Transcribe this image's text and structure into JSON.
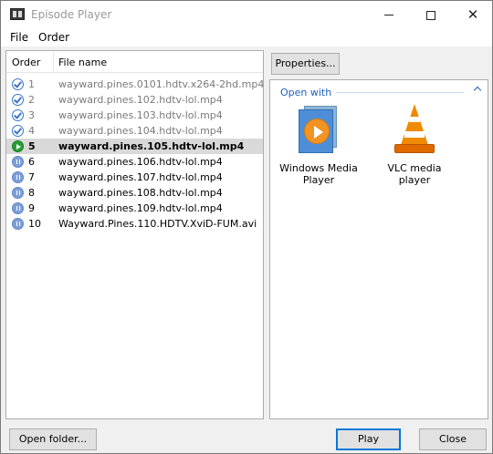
{
  "window": {
    "title": "Episode Player",
    "minimize_glyph": "",
    "maximize_glyph": "",
    "close_glyph": "✕"
  },
  "menu": {
    "file": "File",
    "order": "Order"
  },
  "list": {
    "headers": {
      "order": "Order",
      "file_name": "File name"
    },
    "rows": [
      {
        "order": "1",
        "file": "wayward.pines.0101.hdtv.x264-2hd.mp4",
        "status": "watched"
      },
      {
        "order": "2",
        "file": "wayward.pines.102.hdtv-lol.mp4",
        "status": "watched"
      },
      {
        "order": "3",
        "file": "wayward.pines.103.hdtv-lol.mp4",
        "status": "watched"
      },
      {
        "order": "4",
        "file": "wayward.pines.104.hdtv-lol.mp4",
        "status": "watched"
      },
      {
        "order": "5",
        "file": "wayward.pines.105.hdtv-lol.mp4",
        "status": "selected"
      },
      {
        "order": "6",
        "file": "wayward.pines.106.hdtv-lol.mp4",
        "status": "queued"
      },
      {
        "order": "7",
        "file": "wayward.pines.107.hdtv-lol.mp4",
        "status": "queued"
      },
      {
        "order": "8",
        "file": "wayward.pines.108.hdtv-lol.mp4",
        "status": "queued"
      },
      {
        "order": "9",
        "file": "wayward.pines.109.hdtv-lol.mp4",
        "status": "queued"
      },
      {
        "order": "10",
        "file": "Wayward.Pines.110.HDTV.XviD-FUM.avi",
        "status": "queued"
      }
    ]
  },
  "properties_button": "Properties...",
  "open_with": {
    "header": "Open with",
    "apps": [
      {
        "name": "Windows Media Player",
        "icon": "windows-media-player-icon"
      },
      {
        "name": "VLC media player",
        "icon": "vlc-icon"
      }
    ]
  },
  "buttons": {
    "open_folder": "Open folder...",
    "play": "Play",
    "close": "Close"
  },
  "colors": {
    "accent": "#0078d7",
    "group_header": "#1f5fbf",
    "playing": "#26a034",
    "watched": "#3c74c6",
    "queued": "#7ea0d8"
  }
}
